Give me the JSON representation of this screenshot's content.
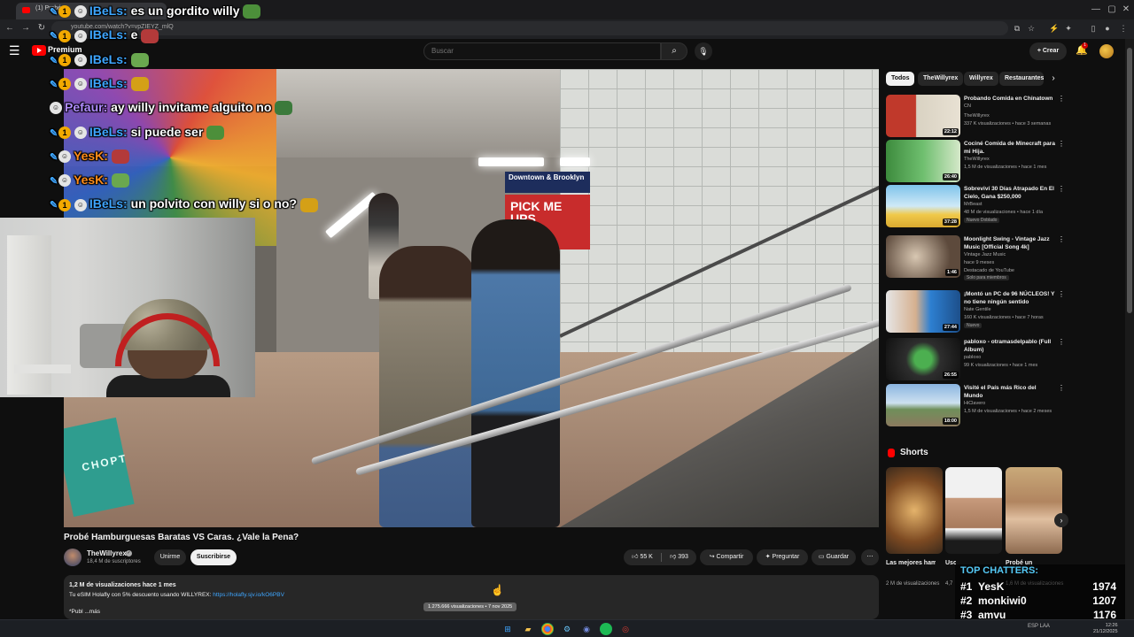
{
  "browser": {
    "tab_title": "(1) Probé...",
    "url": "youtube.com/watch?v=vpZIEYZ_mlQ",
    "window_controls": [
      "minimize",
      "maximize",
      "close"
    ]
  },
  "header": {
    "logo_text": "Premium",
    "search_placeholder": "Buscar",
    "create_label": "Crear",
    "notifications_count": "1"
  },
  "overlay_chat": [
    {
      "user": "IBeLs:",
      "message": "es un gordito willy",
      "user_color": "#3ea6ff",
      "badges": true,
      "pinned": true
    },
    {
      "user": "IBeLs:",
      "message": "e",
      "user_color": "#3ea6ff",
      "badges": true,
      "pinned": true
    },
    {
      "user": "IBeLs:",
      "message": "",
      "user_color": "#3ea6ff",
      "badges": true,
      "pinned": true
    },
    {
      "user": "IBeLs:",
      "message": "",
      "user_color": "#3ea6ff",
      "badges": true,
      "pinned": true
    },
    {
      "user": "Pefaur:",
      "message": "ay willy invitame alguito no",
      "user_color": "#b08cff",
      "badges": false,
      "pinned": false
    },
    {
      "user": "IBeLs:",
      "message": "si puede ser",
      "user_color": "#3ea6ff",
      "badges": true,
      "pinned": true
    },
    {
      "user": "YesK:",
      "message": "",
      "user_color": "#ff8c1a",
      "badges": false,
      "pinned": true
    },
    {
      "user": "YesK:",
      "message": "",
      "user_color": "#ff8c1a",
      "badges": false,
      "pinned": true
    },
    {
      "user": "IBeLs:",
      "message": "un polvito con willy si o no?",
      "user_color": "#3ea6ff",
      "badges": true,
      "pinned": true
    }
  ],
  "video_scene": {
    "sign_blue": "Downtown & Brooklyn",
    "sign_red": "PICK ME UPS",
    "sign_red_small": "DROP-OFFS",
    "bag_text": "CHOPT"
  },
  "video": {
    "title": "Probé Hamburguesas Baratas VS Caras. ¿Vale la Pena?",
    "channel": "TheWillyrex",
    "subscribers": "18,4 M de suscriptores",
    "join_label": "Unirme",
    "subscribe_label": "Suscribirse",
    "likes": "55 K",
    "dislikes": "393",
    "share_label": "Compartir",
    "ask_label": "Preguntar",
    "save_label": "Guardar",
    "stats": "1,2 M de visualizaciones  hace 1 mes",
    "desc_text": "Tu eSIM Holafly con 5% descuento usando WILLYREX: ",
    "desc_link": "https://holafly.sjv.io/kO6PBV",
    "desc_more": "*Publ   ...más",
    "tooltip": "1.275.666 visualizaciones • 7 nov 2025"
  },
  "chips": [
    "Todos",
    "TheWillyrex",
    "Willyrex",
    "Restaurantes"
  ],
  "recommendations": [
    {
      "title": "Probando Comida en Chinatown",
      "channel": "TheWillyrex",
      "meta": "337 K visualizaciones • hace 3 semanas",
      "duration": "22:12",
      "badge": "CN",
      "tag": ""
    },
    {
      "title": "Cociné Comida de Minecraft para mi Hija.",
      "channel": "TheWillyrex",
      "meta": "1,5 M de visualizaciones • hace 1 mes",
      "duration": "26:40",
      "badge": "",
      "tag": ""
    },
    {
      "title": "Sobreviví 30 Días Atrapado En El Cielo, Gana $250,000",
      "channel": "MrBeast",
      "meta": "48 M de visualizaciones • hace 1 día",
      "duration": "37:28",
      "badge": "",
      "tag": "Nuevo   Doblado"
    },
    {
      "title": "Moonlight Swing - Vintage Jazz Music [Official Song 4k]",
      "channel": "Vintage Jazz Music",
      "meta": "hace 9 meses",
      "duration": "1:46",
      "badge": "Destacado de YouTube",
      "tag": "Solo para miembros"
    },
    {
      "title": "¡Montó un PC de 96 NÚCLEOS! Y no tiene ningún sentido",
      "channel": "Nate Gentile",
      "meta": "160 K visualizaciones • hace 7 horas",
      "duration": "27:44",
      "badge": "",
      "tag": "Nuevo"
    },
    {
      "title": "pabloxo - otramasdelpablo (Full Album)",
      "channel": "pabloxo",
      "meta": "99 K visualizaciones • hace 1 mes",
      "duration": "26:55",
      "badge": "",
      "tag": ""
    },
    {
      "title": "Visité el País más Rico del Mundo",
      "channel": "HiClavero",
      "meta": "1,5 M de visualizaciones • hace 2 meses",
      "duration": "18:00",
      "badge": "",
      "tag": ""
    }
  ],
  "shorts": {
    "heading": "Shorts",
    "items": [
      {
        "title": "Las mejores hamburgue...",
        "views": "2 M de visualizaciones"
      },
      {
        "title": "Uso un Mi...",
        "views": "4,7"
      },
      {
        "title": "Probé un",
        "views": "1,6 M de visualizaciones"
      }
    ]
  },
  "chatters": {
    "title": "TOP CHATTERS:",
    "list": [
      {
        "rank": "#1",
        "name": "YesK",
        "count": "1974"
      },
      {
        "rank": "#2",
        "name": "monkiwi0",
        "count": "1207"
      },
      {
        "rank": "#3",
        "name": "amvu",
        "count": "1176"
      }
    ]
  },
  "taskbar": {
    "tray_text": "ESP LAA",
    "clock_time": "12:26",
    "clock_date": "21/12/2025"
  },
  "colors": {
    "accent_red": "#ff0000",
    "link_blue": "#3ea6ff",
    "background": "#0f0f0f",
    "chatters_title": "#54c8f5"
  }
}
